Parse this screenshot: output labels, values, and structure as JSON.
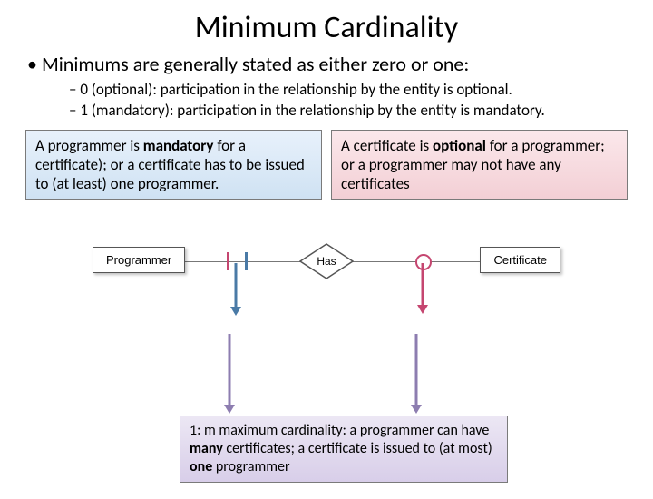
{
  "title": "Minimum Cardinality",
  "bullets": {
    "l1": "Minimums are generally stated as either zero or one:",
    "l2a": "0 (optional): participation in the relationship by the entity is optional.",
    "l2b": "1 (mandatory): participation in the relationship by the entity is mandatory."
  },
  "callouts": {
    "left_pre": "A programmer is ",
    "left_b": "mandatory",
    "left_post": " for a certificate); or a certificate has to be issued to (at least) one programmer.",
    "right_pre": "A certificate is ",
    "right_b": "optional",
    "right_post": " for a programmer; or a programmer may not have any certificates"
  },
  "erd": {
    "left_entity": "Programmer",
    "relationship": "Has",
    "right_entity": "Certificate"
  },
  "bottom": {
    "pre": "1: m maximum cardinality: a programmer can have ",
    "b1": "many",
    "mid": " certificates; a certificate is issued to (at most) ",
    "b2": "one",
    "post": " programmer"
  }
}
